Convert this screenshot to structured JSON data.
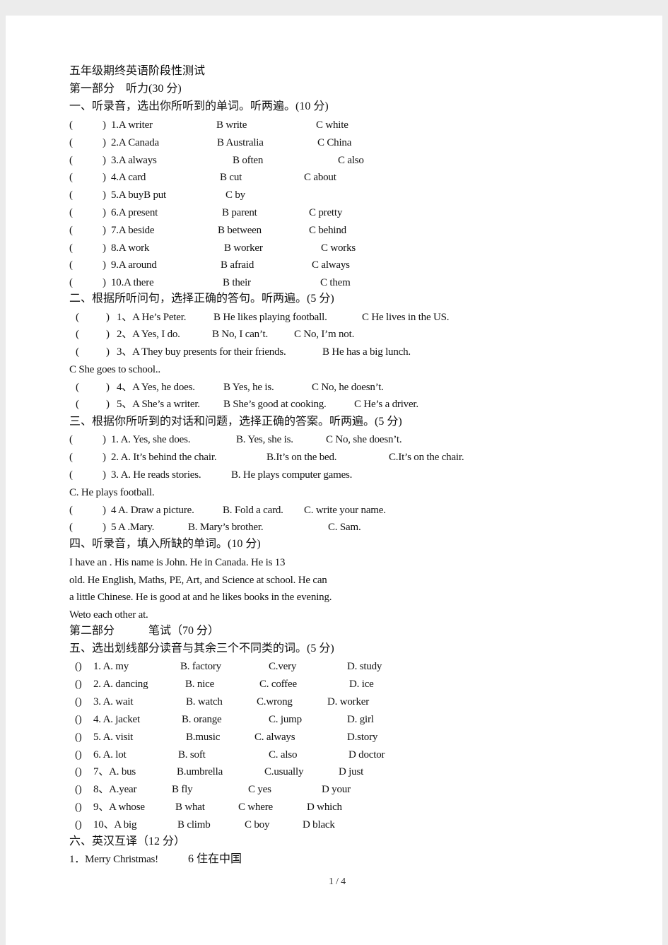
{
  "title": "五年级期终英语阶段性测试",
  "part1": "第一部分　听力(30 分)",
  "sec1": {
    "heading": "一、听录音，选出你所听到的单词。听两遍。(10 分)",
    "rows": [
      [
        "(",
        ")",
        "1.A  writer",
        "B  write",
        "C  white"
      ],
      [
        "(",
        ")",
        "2.A  Canada",
        "B  Australia",
        "C  China"
      ],
      [
        "(",
        ")",
        "3.A  always",
        "B  often",
        "C  also"
      ],
      [
        "(",
        ")",
        "4.A  card",
        "B  cut",
        "C  about"
      ],
      [
        "(",
        ")",
        "5.A  buyB  put",
        "C  by"
      ],
      [
        "(",
        ")",
        "6.A  present",
        "B  parent",
        "C  pretty"
      ],
      [
        "(",
        ")",
        "7.A  beside",
        "B  between",
        "C  behind"
      ],
      [
        "(",
        ")",
        "8.A  work",
        "B  worker",
        "C  works"
      ],
      [
        "(",
        ")",
        "9.A  around",
        "B  afraid",
        "C  always"
      ],
      [
        "(",
        ")",
        "10.A  there",
        "B  their",
        "C  them"
      ]
    ]
  },
  "sec2": {
    "heading": "二、根据所听问句，选择正确的答句。听两遍。(5 分)",
    "rows": [
      [
        "(",
        ")",
        "1、A  He’s  Peter.",
        "B  He  likes  playing  football.",
        "C  He  lives  in  the  US."
      ],
      [
        "(",
        ")",
        "2、A  Yes,  I  do.",
        "B  No,  I  can’t.",
        "C  No,  I’m  not."
      ],
      [
        "(",
        ")",
        "3、A  They  buy  presents  for  their  friends.",
        "B  He  has  a  big  lunch."
      ],
      [
        "(",
        ")",
        "4、A  Yes,  he  does.",
        "B  Yes,  he  is.",
        "C  No,  he  doesn’t."
      ],
      [
        "(",
        ")",
        "5、A  She’s  a  writer.",
        "B  She’s  good  at  cooking.",
        "C  He’s  a  driver."
      ]
    ],
    "row3_continued": "C  She  goes  to  school.."
  },
  "sec3": {
    "heading": "三、根据你所听到的对话和问题，选择正确的答案。听两遍。(5 分)",
    "rows": [
      [
        "(",
        ")",
        "1.  A.  Yes,  she  does.",
        "B.  Yes,  she  is.",
        "C  No,  she  doesn’t."
      ],
      [
        "(",
        ")",
        "2.  A.  It’s  behind  the  chair.",
        "B.It’s  on  the  bed.",
        "C.It’s  on  the  chair."
      ],
      [
        "(",
        ")",
        "3.  A.  He  reads  stories.",
        "B.  He  plays  computer  games."
      ],
      [
        "(",
        ")",
        "4  A.  Draw  a  picture.",
        "B.  Fold  a  card.",
        "C.  write  your  name."
      ],
      [
        "(",
        ")",
        "5  A  .Mary.",
        "B.  Mary’s  brother.",
        "C.  Sam."
      ]
    ],
    "row3_continued": "C.  He  plays  football."
  },
  "sec4": {
    "heading": "四、听录音，填入所缺的单词。(10 分)",
    "lines": [
      "I  have  an  .  His  name  is  John.  He     in  Canada.  He  is  13",
      "old.  He     English,  Maths,  PE,  Art,  and  Science  at  school.  He  can",
      "a  little  Chinese.  He  is  good  at  and  he  likes     books  in  the  evening.",
      "Weto  each  other  at."
    ]
  },
  "part2": "第二部分　　　笔试（70 分）",
  "sec5": {
    "heading": "五、选出划线部分读音与其余三个不同类的词。(5 分)",
    "rows": [
      [
        "()",
        "1.  A.  my",
        "B.  factory",
        "C.very",
        "D.  study"
      ],
      [
        "()",
        "2.  A.  dancing",
        "B.  nice",
        "C.  coffee",
        "D.  ice"
      ],
      [
        "()",
        "3.  A.  wait",
        "B.  watch",
        "C.wrong",
        "D.  worker"
      ],
      [
        "()",
        "4.  A.  jacket",
        "B.  orange",
        "C.  jump",
        "D.  girl"
      ],
      [
        "()",
        "5.  A.  visit",
        "B.music",
        "C.  always",
        "D.story"
      ],
      [
        "()",
        "6.  A.  lot",
        "B.  soft",
        "C.  also",
        "D  doctor"
      ],
      [
        "()",
        "7、A.  bus",
        "B.umbrella",
        "C.usually",
        "D  just"
      ],
      [
        "()",
        "8、A.year",
        "B  fly",
        "C  yes",
        "D  your"
      ],
      [
        "()",
        "9、A  whose",
        "B  what",
        "C  where",
        "D  which"
      ],
      [
        "()",
        "10、A  big",
        "B  climb",
        "C  boy",
        "D  black"
      ]
    ]
  },
  "sec6": {
    "heading": "六、英汉互译（12 分）",
    "line": [
      "1．Merry  Christmas!",
      "6   住在中国"
    ]
  },
  "page_number": "1 / 4"
}
